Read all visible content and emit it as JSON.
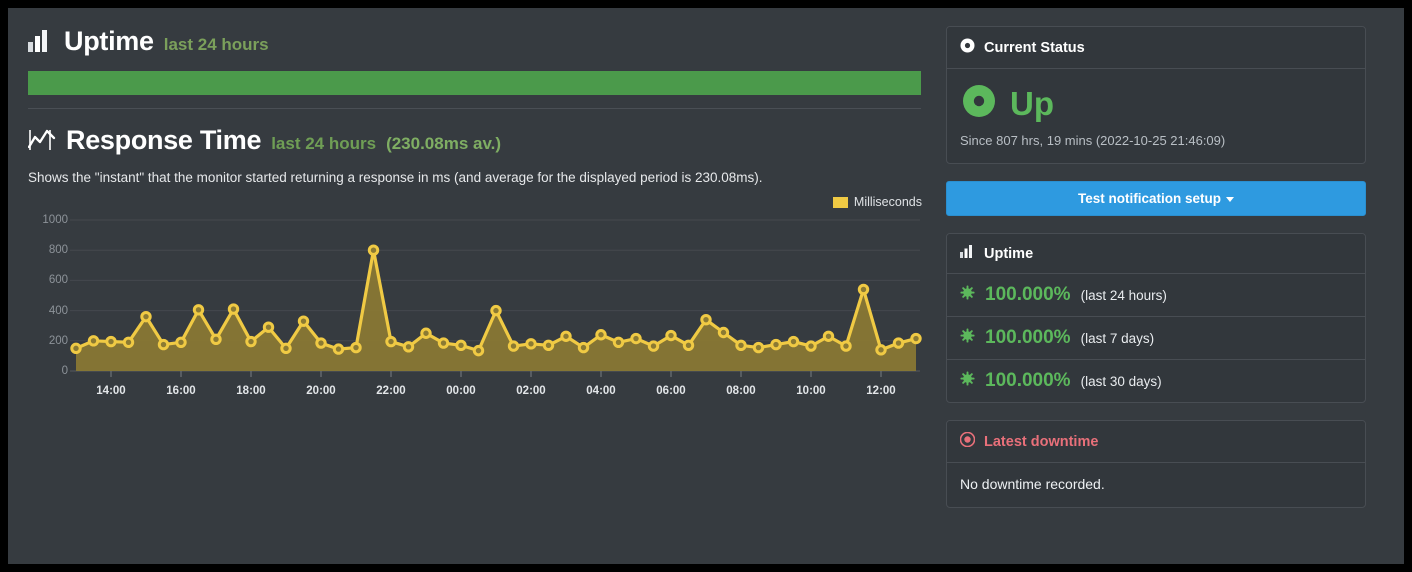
{
  "uptime_section": {
    "icon": "bar-chart-icon",
    "title": "Uptime",
    "subtitle": "last 24 hours",
    "bar_color": "#4b9a4b",
    "bar_percent": 100
  },
  "response_section": {
    "icon": "line-chart-icon",
    "title": "Response Time",
    "subtitle": "last 24 hours",
    "average_label": "(230.08ms av.)",
    "description": "Shows the \"instant\" that the monitor started returning a response in ms (and average for the displayed period is 230.08ms)."
  },
  "chart_data": {
    "type": "area",
    "title": "Response Time",
    "xlabel": "",
    "ylabel": "Milliseconds",
    "legend": [
      {
        "name": "Milliseconds",
        "color": "#f0ca44"
      }
    ],
    "legend_position": "top-right",
    "grid": true,
    "ylim": [
      0,
      1000
    ],
    "yticks": [
      0,
      200,
      400,
      600,
      800,
      1000
    ],
    "xticks": [
      "14:00",
      "16:00",
      "18:00",
      "20:00",
      "22:00",
      "00:00",
      "02:00",
      "04:00",
      "06:00",
      "08:00",
      "10:00",
      "12:00"
    ],
    "line_color": "#f0ca44",
    "fill_color": "#8b7a33",
    "x": [
      "13:00",
      "13:30",
      "14:00",
      "14:30",
      "15:00",
      "15:30",
      "16:00",
      "16:30",
      "17:00",
      "17:30",
      "18:00",
      "18:30",
      "19:00",
      "19:30",
      "20:00",
      "20:30",
      "21:00",
      "21:30",
      "22:00",
      "22:30",
      "23:00",
      "23:30",
      "00:00",
      "00:30",
      "01:00",
      "01:30",
      "02:00",
      "02:30",
      "03:00",
      "03:30",
      "04:00",
      "04:30",
      "05:00",
      "05:30",
      "06:00",
      "06:30",
      "07:00",
      "07:30",
      "08:00",
      "08:30",
      "09:00",
      "09:30",
      "10:00",
      "10:30",
      "11:00",
      "11:30",
      "12:00",
      "12:30",
      "13:00"
    ],
    "values": [
      150,
      200,
      195,
      190,
      360,
      175,
      190,
      405,
      210,
      410,
      195,
      290,
      150,
      330,
      185,
      145,
      155,
      800,
      195,
      160,
      250,
      185,
      170,
      135,
      400,
      165,
      180,
      170,
      230,
      155,
      240,
      190,
      215,
      165,
      235,
      170,
      340,
      255,
      170,
      155,
      175,
      195,
      165,
      230,
      165,
      540,
      140,
      185,
      215
    ],
    "series": [
      {
        "name": "Milliseconds",
        "values": [
          150,
          200,
          195,
          190,
          360,
          175,
          190,
          405,
          210,
          410,
          195,
          290,
          150,
          330,
          185,
          145,
          155,
          800,
          195,
          160,
          250,
          185,
          170,
          135,
          400,
          165,
          180,
          170,
          230,
          155,
          240,
          190,
          215,
          165,
          235,
          170,
          340,
          255,
          170,
          155,
          175,
          195,
          165,
          230,
          165,
          540,
          140,
          185,
          215
        ]
      }
    ]
  },
  "current_status": {
    "header_icon": "record-circle-icon",
    "header": "Current Status",
    "status_icon": "status-up-icon",
    "status": "Up",
    "status_color": "#5cb85c",
    "since": "Since 807 hrs, 19 mins (2022-10-25 21:46:09)"
  },
  "test_button": {
    "label": "Test notification setup",
    "color": "#2e9ae0",
    "has_caret": true
  },
  "uptime_panel": {
    "header_icon": "bar-chart-icon",
    "header": "Uptime",
    "rows": [
      {
        "icon": "asterisk-icon",
        "percent": "100.000%",
        "period": "(last 24 hours)"
      },
      {
        "icon": "asterisk-icon",
        "percent": "100.000%",
        "period": "(last 7 days)"
      },
      {
        "icon": "asterisk-icon",
        "percent": "100.000%",
        "period": "(last 30 days)"
      }
    ]
  },
  "downtime_panel": {
    "header_icon": "record-circle-icon",
    "header": "Latest downtime",
    "header_color": "#e8707a",
    "body": "No downtime recorded."
  }
}
